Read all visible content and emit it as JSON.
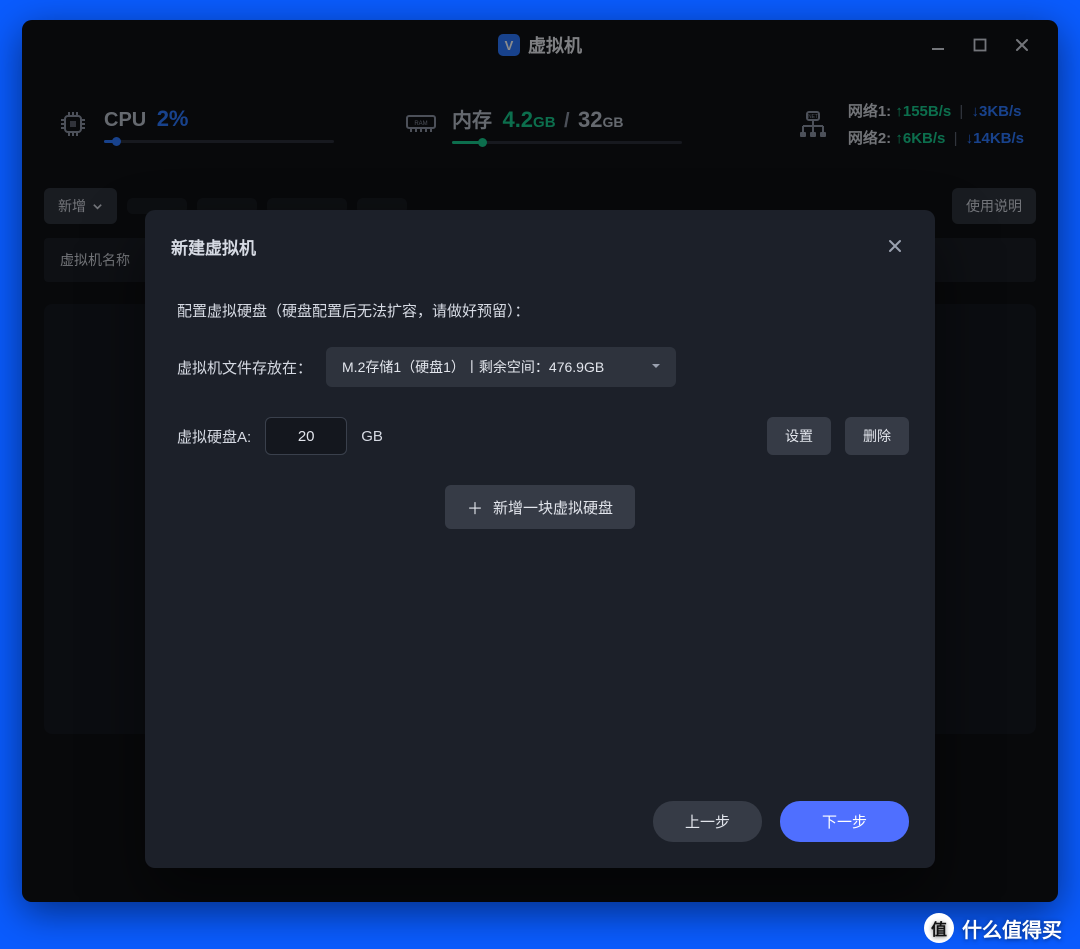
{
  "titlebar": {
    "app_icon_letter": "V",
    "title": "虚拟机"
  },
  "stats": {
    "cpu": {
      "label": "CPU",
      "value": "2%"
    },
    "mem": {
      "label": "内存",
      "used_val": "4.2",
      "used_unit": "GB",
      "slash": "/",
      "total_val": "32",
      "total_unit": "GB"
    },
    "net": [
      {
        "label": "网络1:",
        "up": "155B/s",
        "down": "3KB/s"
      },
      {
        "label": "网络2:",
        "up": "6KB/s",
        "down": "14KB/s"
      }
    ]
  },
  "toolbar": {
    "add_label": "新增",
    "help_label": "使用说明"
  },
  "table": {
    "col_name": "虚拟机名称"
  },
  "modal": {
    "title": "新建虚拟机",
    "hint": "配置虚拟硬盘（硬盘配置后无法扩容，请做好预留）：",
    "storage_label": "虚拟机文件存放在：",
    "storage_selected": "M.2存储1（硬盘1）丨剩余空间：476.9GB",
    "disk_a_label": "虚拟硬盘A:",
    "disk_a_value": "20",
    "disk_unit": "GB",
    "settings_btn": "设置",
    "delete_btn": "删除",
    "add_disk_btn": "新增一块虚拟硬盘",
    "prev_btn": "上一步",
    "next_btn": "下一步"
  },
  "watermark": {
    "circle": "值",
    "text": "什么值得买"
  }
}
